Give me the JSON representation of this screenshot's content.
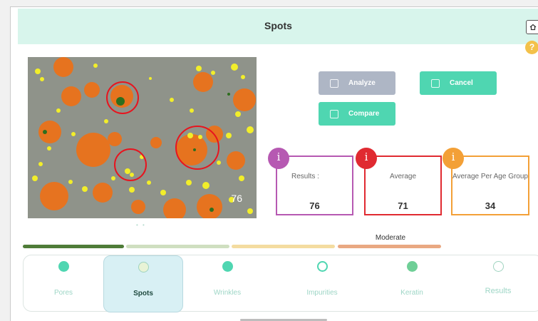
{
  "header": {
    "title": "Spots",
    "home_icon": "home-icon",
    "help_label": "?"
  },
  "image": {
    "score": "76",
    "pager": "• •"
  },
  "actions": {
    "analyze_label": "Analyze",
    "cancel_label": "Cancel",
    "compare_label": "Compare"
  },
  "cards": {
    "badge": "i",
    "results": {
      "label": "Results :",
      "value": "76",
      "color": "#b659b2"
    },
    "average": {
      "label": "Average",
      "value": "71",
      "color": "#e02a31"
    },
    "age_group": {
      "label": "Average Per Age Group",
      "value": "34",
      "color": "#f3a037"
    }
  },
  "severity": {
    "label": "Moderate",
    "segments": [
      "#4f7c38",
      "#cfdfc0",
      "#f4dca0",
      "#e9a882"
    ]
  },
  "tabs": [
    {
      "label": "Pores",
      "icon": "pores-icon"
    },
    {
      "label": "Spots",
      "icon": "spots-icon",
      "active": true
    },
    {
      "label": "Wrinkles",
      "icon": "wrinkles-icon"
    },
    {
      "label": "Impurities",
      "icon": "impurities-icon"
    },
    {
      "label": "Keratin",
      "icon": "keratin-icon"
    },
    {
      "label": "Results",
      "icon": "results-icon"
    }
  ],
  "colors": {
    "accent": "#4fd6b1",
    "header_bg": "#d8f5ec",
    "disabled": "#aeb6c5"
  }
}
